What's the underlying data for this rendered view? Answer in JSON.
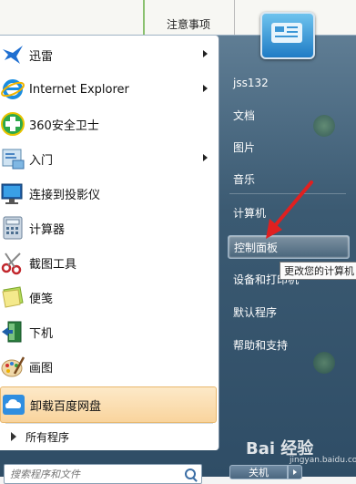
{
  "background": {
    "notice": "注意事项"
  },
  "programs": [
    {
      "label": "迅雷",
      "icon": "bird-icon",
      "submenu": true
    },
    {
      "label": "Internet Explorer",
      "icon": "internet-explorer-icon",
      "submenu": true
    },
    {
      "label": "360安全卫士",
      "icon": "shield-plus-icon",
      "submenu": false
    },
    {
      "label": "入门",
      "icon": "getting-started-icon",
      "submenu": true
    },
    {
      "label": "连接到投影仪",
      "icon": "projector-icon",
      "submenu": false
    },
    {
      "label": "计算器",
      "icon": "calculator-icon",
      "submenu": false
    },
    {
      "label": "截图工具",
      "icon": "scissors-icon",
      "submenu": false
    },
    {
      "label": "便笺",
      "icon": "sticky-note-icon",
      "submenu": false
    },
    {
      "label": "下机",
      "icon": "exit-door-icon",
      "submenu": false
    },
    {
      "label": "画图",
      "icon": "paint-palette-icon",
      "submenu": false
    },
    {
      "label": "卸载百度网盘",
      "icon": "cloud-icon",
      "submenu": false
    }
  ],
  "all_programs": "所有程序",
  "search": {
    "placeholder": "搜索程序和文件"
  },
  "right_items": [
    {
      "label": "jss132"
    },
    {
      "label": "文档"
    },
    {
      "label": "图片"
    },
    {
      "label": "音乐"
    },
    {
      "label": "计算机"
    },
    {
      "label": "控制面板"
    },
    {
      "label": "设备和打印机"
    },
    {
      "label": "默认程序"
    },
    {
      "label": "帮助和支持"
    }
  ],
  "tooltip": "更改您的计算机",
  "shutdown": "关机",
  "watermark": {
    "brand": "Bai 经验",
    "url": "jingyan.baidu.com"
  }
}
